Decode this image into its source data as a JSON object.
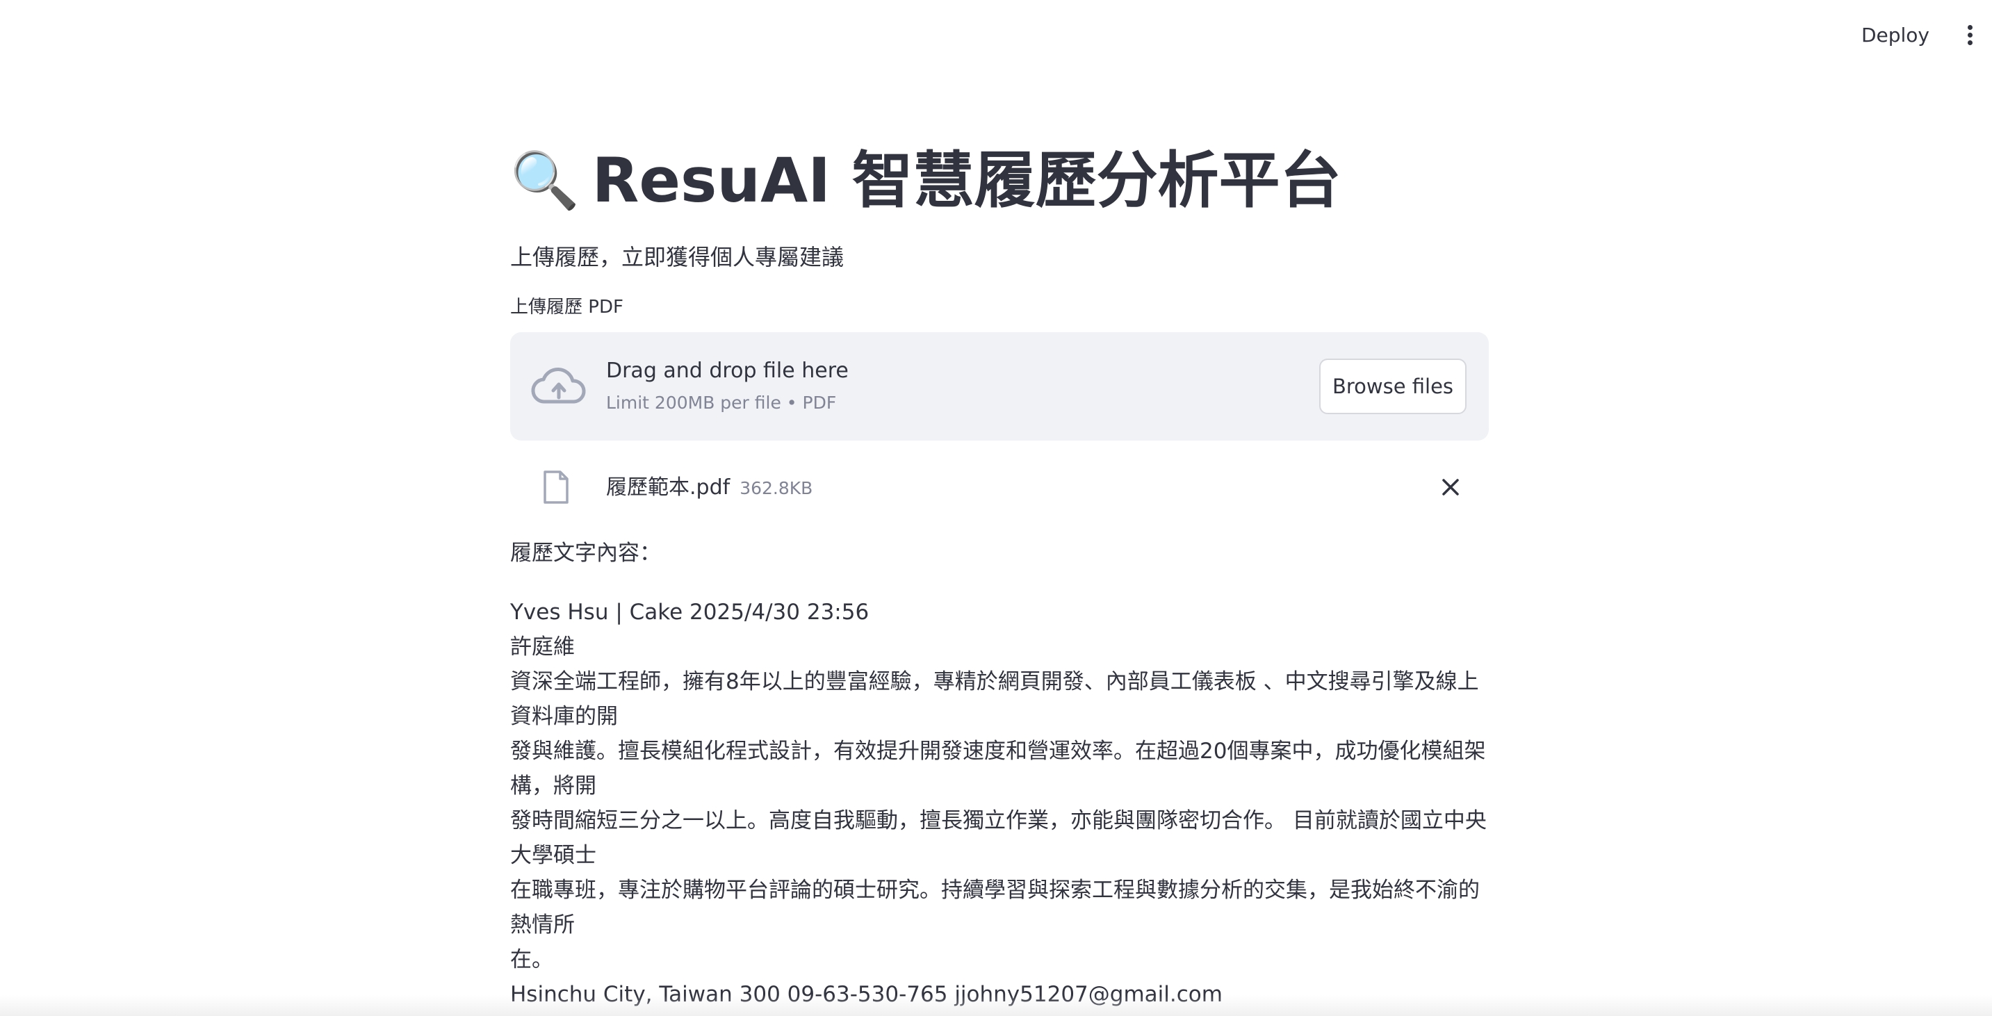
{
  "header": {
    "deploy_label": "Deploy",
    "menu_icon": "more-vertical-icon"
  },
  "main": {
    "title_icon": "🔍",
    "title": "ResuAI 智慧履歷分析平台",
    "subtitle": "上傳履歷，立即獲得個人專屬建議"
  },
  "uploader": {
    "label": "上傳履歷 PDF",
    "drag_text": "Drag and drop file here",
    "limit_text": "Limit 200MB per file • PDF",
    "browse_label": "Browse files",
    "icon": "cloud-upload-icon"
  },
  "uploaded_file": {
    "name": "履歷範本.pdf",
    "size": "362.8KB",
    "icon": "file-icon",
    "remove_icon": "close-icon"
  },
  "resume": {
    "label": "履歷文字內容：",
    "lines": [
      "Yves Hsu | Cake 2025/4/30 23:56",
      "許庭維",
      "資深全端工程師，擁有8年以上的豐富經驗，專精於網頁開發、內部員工儀表板 、中文搜尋引擎及線上資料庫的開",
      "發與維護。擅長模組化程式設計，有效提升開發速度和營運效率。在超過20個專案中，成功優化模組架構，將開",
      "發時間縮短三分之一以上。高度自我驅動，擅長獨立作業，亦能與團隊密切合作。 目前就讀於國立中央大學碩士",
      "在職專班，專注於購物平台評論的碩士研究。持續學習與探索工程與數據分析的交集，是我始終不渝的熱情所",
      "在。",
      "Hsinchu City, Taiwan 300 09-63-530-765 jjohny51207@gmail.com"
    ]
  },
  "colors": {
    "text": "#31333f",
    "muted": "#808495",
    "dropzone_bg": "#f0f2f6",
    "icon": "#a3a8b8"
  }
}
